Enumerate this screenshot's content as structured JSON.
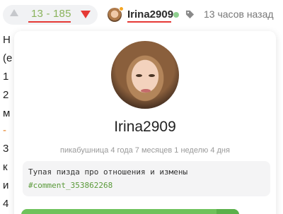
{
  "rating": {
    "text": "13 - 185",
    "color": "#8ab35c"
  },
  "header": {
    "username": "Irina2909",
    "time": "13 часов назад"
  },
  "background_text": {
    "lines": [
      "Н",
      "(е",
      "1",
      "2",
      "м",
      "-",
      "3",
      "к",
      "и",
      "4"
    ]
  },
  "profile_card": {
    "username": "Irina2909",
    "meta": "пикабушница 4 года 7 месяцев 1 неделю 4 дня",
    "note": "Тупая пизда про отношения и измены",
    "note_link": "#comment_353862268"
  },
  "colors": {
    "accent_red": "#e53935",
    "online_green": "#8fcf8f",
    "action_green": "#6ec25b"
  },
  "icons": [
    "vote-up-icon",
    "vote-down-icon",
    "tag-icon",
    "online-indicator"
  ]
}
